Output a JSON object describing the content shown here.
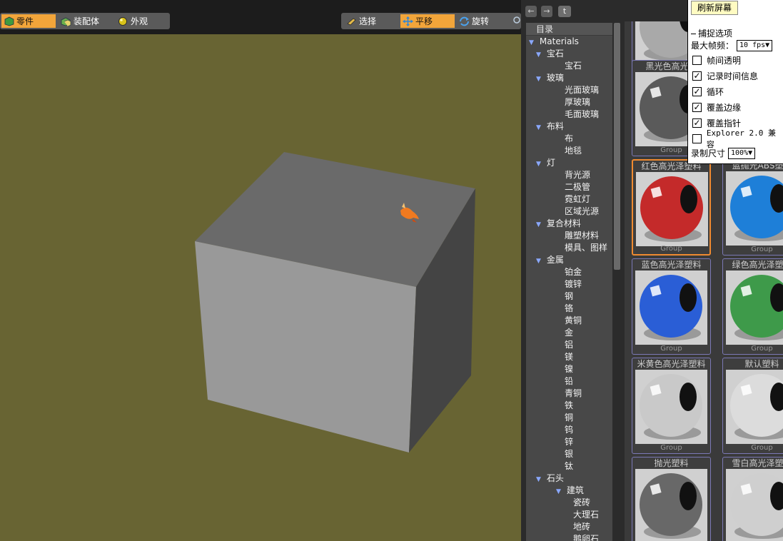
{
  "toolbar_left": [
    {
      "label": "零件",
      "icon": "part-icon",
      "active": true
    },
    {
      "label": "装配体",
      "icon": "assembly-icon",
      "active": false
    },
    {
      "label": "外观",
      "icon": "appearance-icon",
      "active": false
    }
  ],
  "toolbar_right": [
    {
      "label": "选择",
      "icon": "select-icon",
      "active": false
    },
    {
      "label": "平移",
      "icon": "pan-icon",
      "active": true
    },
    {
      "label": "旋转",
      "icon": "rotate-icon",
      "active": false
    }
  ],
  "library": {
    "nav": {
      "back": "←",
      "forward": "→",
      "up": "t"
    },
    "tree_header": "目录",
    "tree": [
      {
        "label": "Materials",
        "level": 0,
        "expanded": true
      },
      {
        "label": "宝石",
        "level": 1,
        "expanded": true
      },
      {
        "label": "宝石",
        "level": 2
      },
      {
        "label": "玻璃",
        "level": 1,
        "expanded": true
      },
      {
        "label": "光面玻璃",
        "level": 2
      },
      {
        "label": "厚玻璃",
        "level": 2
      },
      {
        "label": "毛面玻璃",
        "level": 2
      },
      {
        "label": "布料",
        "level": 1,
        "expanded": true
      },
      {
        "label": "布",
        "level": 2
      },
      {
        "label": "地毯",
        "level": 2
      },
      {
        "label": "灯",
        "level": 1,
        "expanded": true
      },
      {
        "label": "背光源",
        "level": 2
      },
      {
        "label": "二极管",
        "level": 2
      },
      {
        "label": "霓虹灯",
        "level": 2
      },
      {
        "label": "区域光源",
        "level": 2
      },
      {
        "label": "复合材料",
        "level": 1,
        "expanded": true
      },
      {
        "label": "雕塑材料",
        "level": 2
      },
      {
        "label": "模具、图样",
        "level": 2
      },
      {
        "label": "金属",
        "level": 1,
        "expanded": true
      },
      {
        "label": "铂金",
        "level": 2
      },
      {
        "label": "镀锌",
        "level": 2
      },
      {
        "label": "钢",
        "level": 2
      },
      {
        "label": "铬",
        "level": 2
      },
      {
        "label": "黄铜",
        "level": 2
      },
      {
        "label": "金",
        "level": 2
      },
      {
        "label": "铝",
        "level": 2
      },
      {
        "label": "镁",
        "level": 2
      },
      {
        "label": "镍",
        "level": 2
      },
      {
        "label": "铅",
        "level": 2
      },
      {
        "label": "青铜",
        "level": 2
      },
      {
        "label": "铁",
        "level": 2
      },
      {
        "label": "铜",
        "level": 2
      },
      {
        "label": "钨",
        "level": 2
      },
      {
        "label": "锌",
        "level": 2
      },
      {
        "label": "银",
        "level": 2
      },
      {
        "label": "钛",
        "level": 2
      },
      {
        "label": "石头",
        "level": 1,
        "expanded": true
      },
      {
        "label": "建筑",
        "level": 2,
        "expanded": true
      },
      {
        "label": "瓷砖",
        "level": 3
      },
      {
        "label": "大理石",
        "level": 3
      },
      {
        "label": "地砖",
        "level": 3
      },
      {
        "label": "鹅卵石",
        "level": 3
      }
    ],
    "thumbnails": [
      {
        "title": "",
        "group": "Group",
        "color": "#a9a9a9",
        "selected": false
      },
      {
        "title": "黑光色高光泽",
        "group": "Group",
        "color": "#5a5a5a",
        "selected": false
      },
      {
        "title": "",
        "group": "",
        "color": "#8a8a8a",
        "selected": false
      },
      {
        "title": "红色高光泽塑料",
        "group": "Group",
        "color": "#c42a2a",
        "selected": true
      },
      {
        "title": "蓝抛光ABS塑料",
        "group": "Group",
        "color": "#1e7fd8",
        "selected": false
      },
      {
        "title": "蓝色高光泽塑料",
        "group": "Group",
        "color": "#2a5ed6",
        "selected": false
      },
      {
        "title": "绿色高光泽塑料",
        "group": "Group",
        "color": "#3e9a4a",
        "selected": false
      },
      {
        "title": "米黄色高光泽塑料",
        "group": "Group",
        "color": "#c9c9c9",
        "selected": false
      },
      {
        "title": "默认塑料",
        "group": "Group",
        "color": "#dcdcdc",
        "selected": false
      },
      {
        "title": "抛光塑料",
        "group": "",
        "color": "#686868",
        "selected": false
      },
      {
        "title": "雪白高光泽塑料",
        "group": "",
        "color": "#cfcfcf",
        "selected": false
      }
    ]
  },
  "capture": {
    "refresh_label": "刷新屏幕",
    "section_label": "捕捉选项",
    "fps_label": "最大帧频：",
    "fps_value": "10 fps▼",
    "options": [
      {
        "label": "帧间透明",
        "checked": false
      },
      {
        "label": "记录时间信息",
        "checked": true
      },
      {
        "label": "循环",
        "checked": true
      },
      {
        "label": "覆盖边缘",
        "checked": true
      },
      {
        "label": "覆盖指针",
        "checked": true
      },
      {
        "label": "Explorer 2.0 兼容",
        "checked": false
      }
    ],
    "size_label": "录制尺寸",
    "size_value": "100%▼"
  },
  "colors": {
    "viewport_bg": "#686433",
    "accent": "#f2a53a",
    "cube_top": "#6a6a6a",
    "cube_front": "#999999",
    "cube_side": "#444444"
  }
}
